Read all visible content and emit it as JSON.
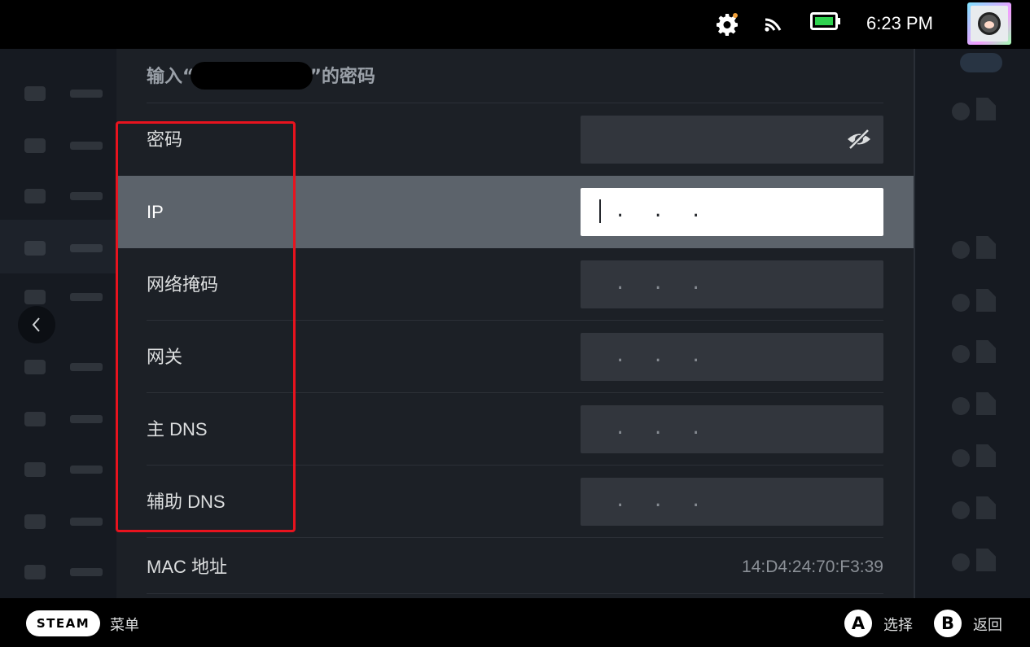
{
  "status_bar": {
    "time": "6:23 PM",
    "icons": [
      "gear-icon",
      "wifi-icon",
      "battery-icon"
    ],
    "avatar": "user-avatar"
  },
  "dialog": {
    "title_prefix": "输入“",
    "title_suffix": "”的密码",
    "rows": [
      {
        "label": "密码",
        "value": "",
        "type": "password"
      },
      {
        "label": "IP",
        "value": ".  .  .",
        "selected": true
      },
      {
        "label": "网络掩码",
        "value": ".  .  ."
      },
      {
        "label": "网关",
        "value": ".  .  ."
      },
      {
        "label": "主 DNS",
        "value": ".  .  ."
      },
      {
        "label": "辅助 DNS",
        "value": ".  .  ."
      }
    ],
    "mac": {
      "label": "MAC 地址",
      "value": "14:D4:24:70:F3:39"
    }
  },
  "bottom_bar": {
    "steam_label": "STEAM",
    "menu_label": "菜单",
    "a_key": "A",
    "a_label": "选择",
    "b_key": "B",
    "b_label": "返回"
  },
  "colors": {
    "background": "#1c2026",
    "selected_row": "#5c636b",
    "field": "#32363d",
    "annotation_red": "#e8131e"
  }
}
